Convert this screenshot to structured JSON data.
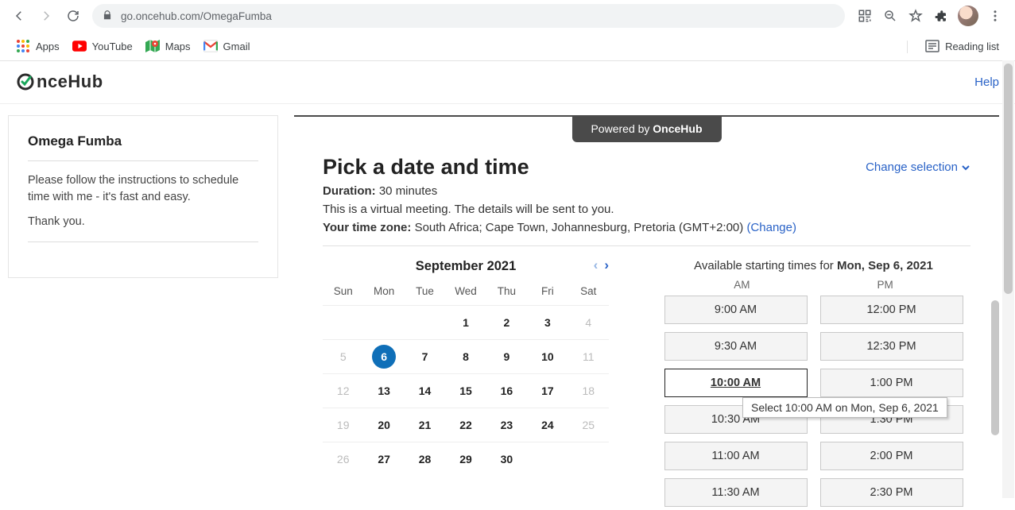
{
  "browser": {
    "url": "go.oncehub.com/OmegaFumba",
    "bookmarks": {
      "apps": "Apps",
      "youtube": "YouTube",
      "maps": "Maps",
      "gmail": "Gmail",
      "reading_list": "Reading list"
    }
  },
  "header": {
    "logo_text": "nceHub",
    "help": "Help"
  },
  "sidebar": {
    "name": "Omega Fumba",
    "line1": "Please follow the instructions to schedule time with me - it's fast and easy.",
    "line2": "Thank you."
  },
  "main": {
    "powered_prefix": "Powered by ",
    "powered_brand": "OnceHub",
    "title": "Pick a date and time",
    "duration_label": "Duration:",
    "duration_value": " 30 minutes",
    "virtual_note": "This is a virtual meeting. The details will be sent to you.",
    "tz_label": "Your time zone:",
    "tz_value": " South Africa;  Cape Town, Johannesburg, Pretoria  (GMT+2:00)  ",
    "tz_change": "(Change)",
    "change_selection": "Change selection"
  },
  "calendar": {
    "month_label": "September 2021",
    "dow": [
      "Sun",
      "Mon",
      "Tue",
      "Wed",
      "Thu",
      "Fri",
      "Sat"
    ],
    "weeks": [
      [
        {
          "n": "",
          "off": true
        },
        {
          "n": "",
          "off": true
        },
        {
          "n": "",
          "off": true
        },
        {
          "n": "1",
          "off": false
        },
        {
          "n": "2",
          "off": false
        },
        {
          "n": "3",
          "off": false
        },
        {
          "n": "4",
          "off": true
        }
      ],
      [
        {
          "n": "5",
          "off": true
        },
        {
          "n": "6",
          "off": false,
          "selected": true
        },
        {
          "n": "7",
          "off": false
        },
        {
          "n": "8",
          "off": false
        },
        {
          "n": "9",
          "off": false
        },
        {
          "n": "10",
          "off": false
        },
        {
          "n": "11",
          "off": true
        }
      ],
      [
        {
          "n": "12",
          "off": true
        },
        {
          "n": "13",
          "off": false
        },
        {
          "n": "14",
          "off": false
        },
        {
          "n": "15",
          "off": false
        },
        {
          "n": "16",
          "off": false
        },
        {
          "n": "17",
          "off": false
        },
        {
          "n": "18",
          "off": true
        }
      ],
      [
        {
          "n": "19",
          "off": true
        },
        {
          "n": "20",
          "off": false
        },
        {
          "n": "21",
          "off": false
        },
        {
          "n": "22",
          "off": false
        },
        {
          "n": "23",
          "off": false
        },
        {
          "n": "24",
          "off": false
        },
        {
          "n": "25",
          "off": true
        }
      ],
      [
        {
          "n": "26",
          "off": true
        },
        {
          "n": "27",
          "off": false
        },
        {
          "n": "28",
          "off": false
        },
        {
          "n": "29",
          "off": false
        },
        {
          "n": "30",
          "off": false
        },
        {
          "n": "",
          "off": true
        },
        {
          "n": "",
          "off": true
        }
      ]
    ]
  },
  "times": {
    "title_prefix": "Available starting times for ",
    "title_date": "Mon, Sep 6, 2021",
    "am_label": "AM",
    "pm_label": "PM",
    "am_slots": [
      "9:00 AM",
      "9:30 AM",
      "10:00 AM",
      "10:30 AM",
      "11:00 AM",
      "11:30 AM"
    ],
    "pm_slots": [
      "12:00 PM",
      "12:30 PM",
      "1:00 PM",
      "1:30 PM",
      "2:00 PM",
      "2:30 PM"
    ],
    "selected": "10:00 AM",
    "tooltip": "Select 10:00 AM on Mon, Sep 6, 2021"
  }
}
